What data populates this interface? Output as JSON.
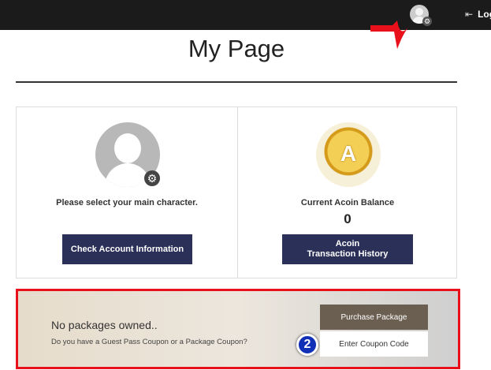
{
  "header": {
    "logout_label": "Logout",
    "logout_icon": "logout-icon",
    "user_icon": "user-settings-icon"
  },
  "page_title": "My Page",
  "character_card": {
    "prompt": "Please select your main character.",
    "button": "Check Account Information"
  },
  "acoin_card": {
    "coin_letter": "A",
    "label": "Current Acoin Balance",
    "balance": "0",
    "button_line1": "Acoin",
    "button_line2": "Transaction History"
  },
  "package": {
    "status": "No packages owned..",
    "question": "Do you have a Guest Pass Coupon or a Package Coupon?",
    "purchase_button": "Purchase Package",
    "coupon_button": "Enter Coupon Code",
    "step_badge": "2"
  },
  "colors": {
    "annotation": "#e8101a",
    "primary_button": "#2b3059",
    "purchase_button": "#6b5f52"
  }
}
